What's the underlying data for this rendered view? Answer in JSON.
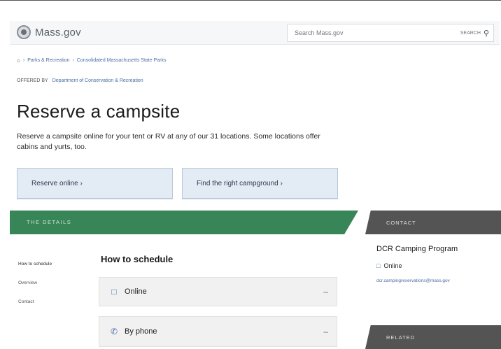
{
  "header": {
    "logo_text": "Mass.gov",
    "search_placeholder": "Search Mass.gov",
    "search_scope": "SEARCH"
  },
  "breadcrumb": {
    "items": [
      "Parks & Recreation",
      "Consolidated Massachusetts State Parks"
    ]
  },
  "org": {
    "offered_by": "OFFERED BY",
    "name": "Department of Conservation & Recreation"
  },
  "page": {
    "title": "Reserve a campsite",
    "description": "Reserve a campsite online for your tent or RV at any of our 31 locations. Some locations offer cabins and yurts, too."
  },
  "cta": {
    "reserve_online": "Reserve online ›",
    "find_campground": "Find the right campground ›"
  },
  "details": {
    "label": "THE DETAILS"
  },
  "contact": {
    "label": "CONTACT",
    "title": "DCR Camping Program",
    "online_label": "Online",
    "email": "dcr.campingreservations@mass.gov"
  },
  "sidenav": {
    "items": [
      "How to schedule",
      "Overview",
      "Contact"
    ]
  },
  "section": {
    "title": "How to schedule",
    "accordion": [
      {
        "label": "Online",
        "icon": "laptop-icon"
      },
      {
        "label": "By phone",
        "icon": "phone-icon"
      }
    ]
  },
  "related": {
    "label": "RELATED"
  }
}
